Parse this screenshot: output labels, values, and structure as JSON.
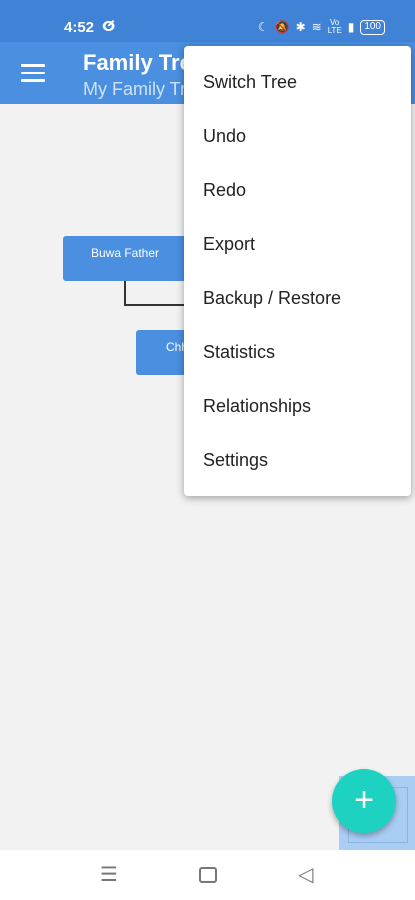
{
  "status_bar": {
    "time": "4:52",
    "app_icon": "ⵚ",
    "battery": "100",
    "volte": "Vo LTE"
  },
  "app_bar": {
    "title": "Family Tree",
    "subtitle": "My Family Tree"
  },
  "tree": {
    "nodes": [
      {
        "label": "Buwa Father"
      },
      {
        "label": "Chh"
      }
    ]
  },
  "menu": {
    "items": [
      {
        "label": "Switch Tree"
      },
      {
        "label": "Undo"
      },
      {
        "label": "Redo"
      },
      {
        "label": "Export"
      },
      {
        "label": "Backup / Restore"
      },
      {
        "label": "Statistics"
      },
      {
        "label": "Relationships"
      },
      {
        "label": "Settings"
      }
    ]
  },
  "fab": {
    "symbol": "+"
  },
  "nav_bar": {
    "recents": "☰",
    "back": "◁"
  },
  "colors": {
    "primary": "#4a8fe0",
    "status": "#3f82d6",
    "fab": "#1ed2c2"
  }
}
